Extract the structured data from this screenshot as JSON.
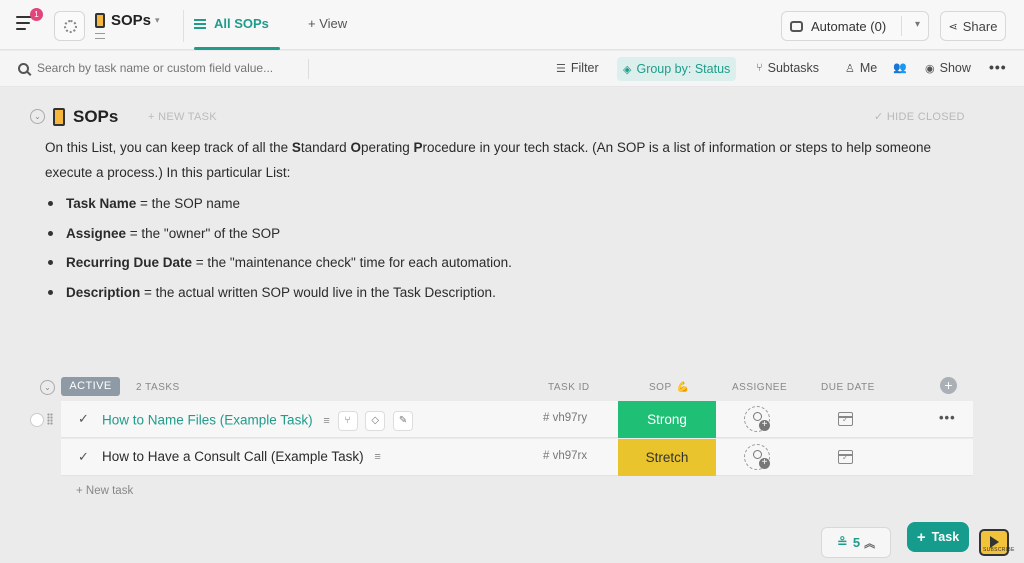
{
  "header": {
    "notification_count": "1",
    "list_title": "SOPs",
    "tab_all_label": "All SOPs",
    "tab_view_label": "+ View",
    "automate_label": "Automate (0)",
    "share_label": "Share"
  },
  "toolbar": {
    "search_placeholder": "Search by task name or custom field value...",
    "filter_label": "Filter",
    "group_by_label": "Group by: Status",
    "subtasks_label": "Subtasks",
    "me_label": "Me",
    "show_label": "Show"
  },
  "list": {
    "title": "SOPs",
    "new_task_label": "+ NEW TASK",
    "hide_closed_label": "✓ HIDE CLOSED",
    "description_prefix": "On this List, you can keep track of all the ",
    "description_s": "S",
    "description_tandard": "tandard ",
    "description_o": "O",
    "description_perating": "perating ",
    "description_p": "P",
    "description_suffix": "rocedure in your tech stack. (An SOP is a list of information or steps to help someone execute a process.) In this particular List:",
    "bullets": [
      {
        "term": "Task Name",
        "text": " = the SOP name"
      },
      {
        "term": "Assignee",
        "text": " = the \"owner\" of the SOP"
      },
      {
        "term": "Recurring Due Date",
        "text": " = the \"maintenance check\" time for each automation."
      },
      {
        "term": "Description",
        "text": " = the actual written SOP would live in the Task Description."
      }
    ]
  },
  "group": {
    "status": "ACTIVE",
    "count": "2 TASKS",
    "columns": {
      "task_id": "TASK ID",
      "sop": "SOP",
      "sop_emoji": "💪",
      "assignee": "ASSIGNEE",
      "due_date": "DUE DATE"
    },
    "tasks": [
      {
        "name": "How to Name Files (Example Task)",
        "task_id": "# vh97ry",
        "sop": "Strong",
        "sop_color": "#1fbf75"
      },
      {
        "name": "How to Have a Consult Call (Example Task)",
        "task_id": "# vh97rx",
        "sop": "Stretch",
        "sop_color": "#e9c42d"
      }
    ],
    "new_task_label": "+ New task"
  },
  "footer": {
    "badge_count": "5",
    "task_button_label": "Task",
    "channel_label": "SUBSCRIBE"
  },
  "colors": {
    "accent": "#1f9c8a",
    "status_active": "#8e9aa6"
  }
}
